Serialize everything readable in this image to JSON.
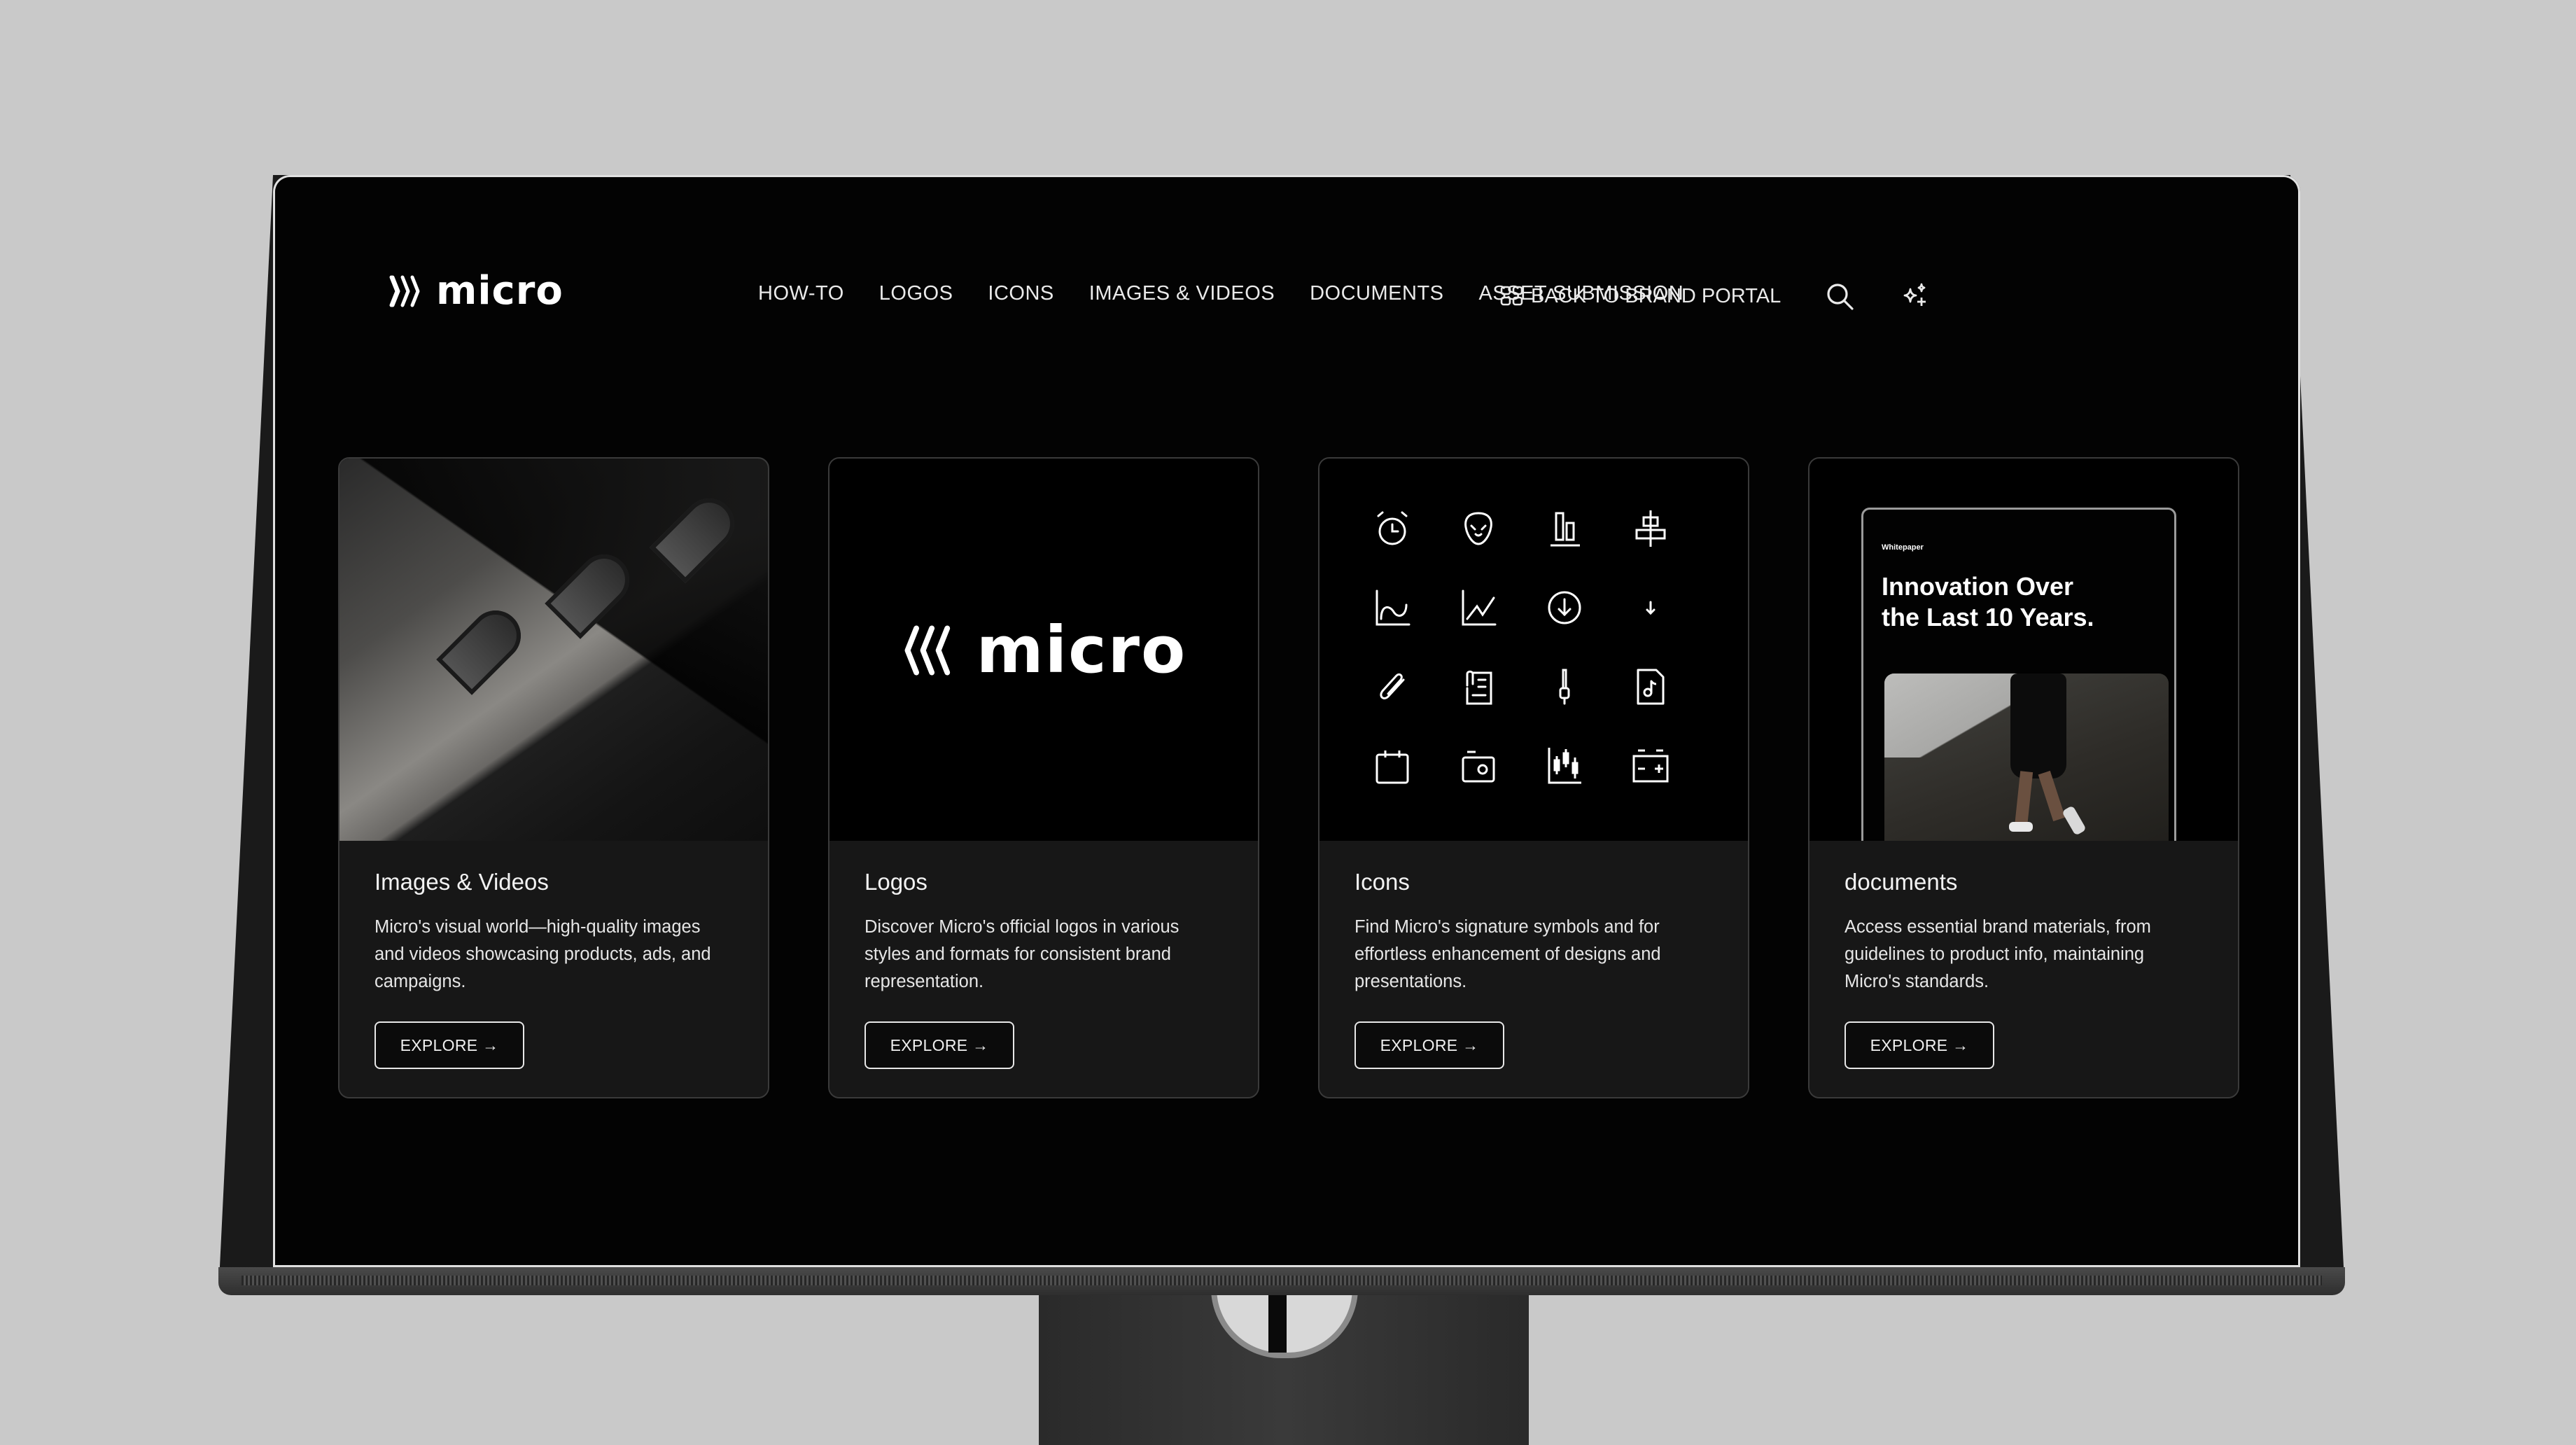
{
  "brand": {
    "name": "micro"
  },
  "nav": {
    "items": [
      "HOW-TO",
      "LOGOS",
      "ICONS",
      "IMAGES & VIDEOS",
      "DOCUMENTS",
      "ASSET SUBMISSION"
    ]
  },
  "header": {
    "back_label": "BACK TO BRAND PORTAL",
    "back_icon": "grid-icon",
    "search_icon": "search-icon",
    "ai_icon": "sparkles-icon"
  },
  "cards": [
    {
      "title": "Images & Videos",
      "description": "Micro's visual world—high-quality images and videos showcasing products, ads, and campaigns.",
      "button": "EXPLORE →",
      "media": "abstract-metal-image"
    },
    {
      "title": "Logos",
      "description": "Discover Micro's official logos in various styles and formats for consistent brand representation.",
      "button": "EXPLORE →",
      "media": "micro-logo",
      "logo_text": "micro"
    },
    {
      "title": "Icons",
      "description": "Find Micro's signature symbols and for effortless enhancement of designs and presentations.",
      "button": "EXPLORE →",
      "media": "icon-grid",
      "icons": [
        "alarm-clock-icon",
        "alien-face-icon",
        "bar-chart-align-bottom-icon",
        "align-center-icon",
        "curve-chart-icon",
        "line-chart-icon",
        "download-circle-icon",
        "arrow-down-icon",
        "paperclip-icon",
        "attached-document-icon",
        "audio-jack-icon",
        "music-file-icon",
        "calendar-icon",
        "camera-icon",
        "candlestick-chart-icon",
        "battery-icon"
      ]
    },
    {
      "title": "documents",
      "description": "Access essential brand materials, from guidelines to product info, maintaining Micro's standards.",
      "button": "EXPLORE →",
      "media": "whitepaper-preview",
      "doc_label": "Whitepaper",
      "doc_headline_1": "Innovation Over",
      "doc_headline_2": "the Last 10 Years."
    }
  ]
}
